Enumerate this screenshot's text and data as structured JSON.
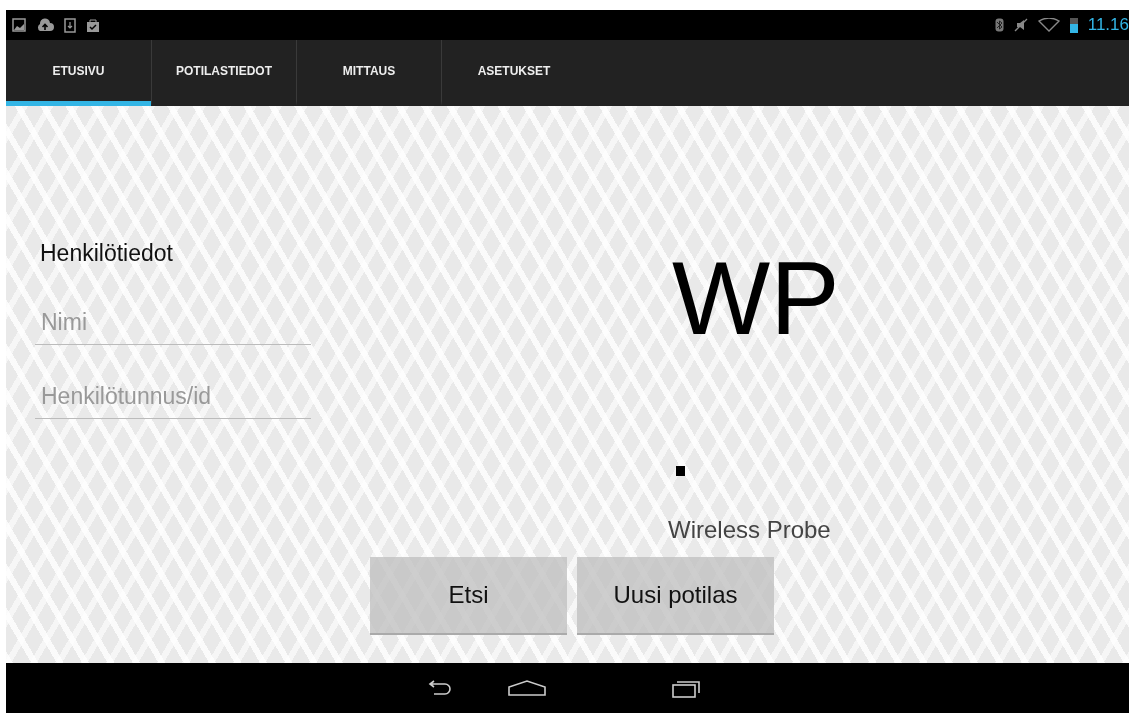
{
  "status_bar": {
    "time": "11.16"
  },
  "tabs": [
    {
      "label": "ETUSIVU",
      "selected": true
    },
    {
      "label": "POTILASTIEDOT",
      "selected": false
    },
    {
      "label": "MITTAUS",
      "selected": false
    },
    {
      "label": "ASETUKSET",
      "selected": false
    }
  ],
  "person_section": {
    "heading": "Henkilötiedot",
    "fields": [
      {
        "placeholder": "Nimi"
      },
      {
        "placeholder": "Henkilötunnus/id"
      }
    ]
  },
  "logo": {
    "title": "WP",
    "subtitle": "Wireless Probe"
  },
  "buttons": [
    "Etsi",
    "Uusi potilas"
  ]
}
